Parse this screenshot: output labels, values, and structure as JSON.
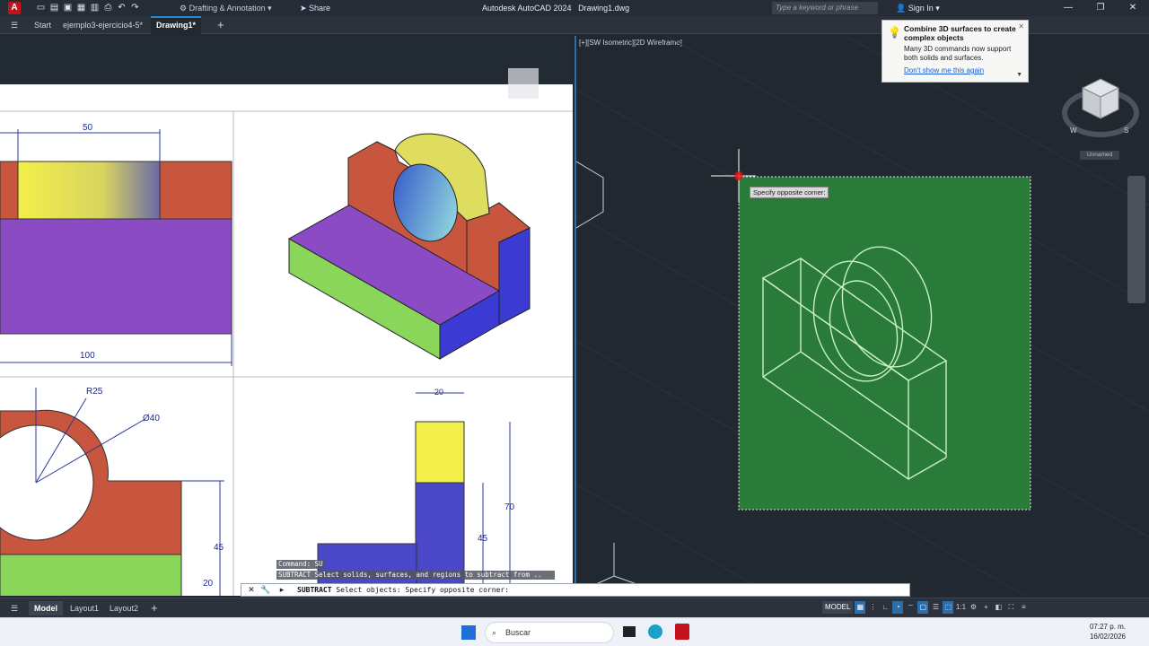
{
  "titlebar": {
    "logo": "A",
    "workspace": "Drafting & Annotation",
    "share": "Share",
    "app": "Autodesk AutoCAD 2024",
    "file": "Drawing1.dwg",
    "search_placeholder": "Type a keyword or phrase",
    "signin": "Sign In"
  },
  "tabs": [
    {
      "label": "Start"
    },
    {
      "label": "ejemplo3-ejercicio4-5*"
    },
    {
      "label": "Drawing1*"
    }
  ],
  "viewport": {
    "label": "[+][SW Isometric][2D Wireframe]",
    "unnamed": "Unnamed",
    "cursor_prompt": "Specify opposite corner:"
  },
  "tooltip": {
    "title": "Combine 3D surfaces to create complex objects",
    "message": "Many 3D commands now support both solids and surfaces.",
    "link": "Don't show me this again"
  },
  "drawing": {
    "dim_50": "50",
    "dim_100": "100",
    "dim_R25": "R25",
    "dim_O40": "Ø40",
    "dim_20_top": "20",
    "dim_70": "70",
    "dim_45_right": "45",
    "dim_45_left": "45",
    "dim_20_left": "20"
  },
  "command": {
    "history1": "Command: SU",
    "history2": "SUBTRACT Select solids, surfaces, and regions to subtract from ..",
    "current_cmd": "SUBTRACT",
    "current_text": "Select objects: Specify opposite corner:"
  },
  "status": {
    "tabs": [
      "Model",
      "Layout1",
      "Layout2"
    ],
    "model": "MODEL",
    "scale": "1:1"
  },
  "taskbar": {
    "search": "Buscar",
    "time": "07:27 p. m.",
    "date": "16/02/2026"
  },
  "colors": {
    "accent": "#2a86d6",
    "selection": "#2a7a3a",
    "wireframe": "#c8f0c8"
  }
}
